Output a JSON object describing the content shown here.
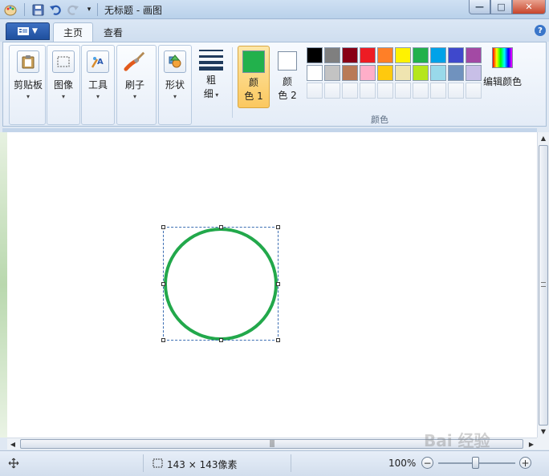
{
  "window": {
    "title": "无标题 - 画图",
    "controls": {
      "minimize": "—",
      "maximize": "□",
      "close": "✕"
    }
  },
  "tabs": [
    {
      "label": "主页",
      "active": true
    },
    {
      "label": "查看",
      "active": false
    }
  ],
  "help": "?",
  "ribbon": {
    "clipboard": {
      "label": "剪贴板"
    },
    "image": {
      "label": "图像"
    },
    "tools": {
      "label": "工具"
    },
    "brushes": {
      "label": "刷子"
    },
    "shapes": {
      "label": "形状"
    },
    "size": {
      "line1": "粗",
      "line2": "细"
    },
    "color1": {
      "line1": "颜",
      "line2": "色 1",
      "color": "#22b14c"
    },
    "color2": {
      "line1": "颜",
      "line2": "色 2",
      "color": "#ffffff"
    },
    "palette": [
      "#000000",
      "#7f7f7f",
      "#880015",
      "#ed1c24",
      "#ff7f27",
      "#fff200",
      "#22b14c",
      "#00a2e8",
      "#3f48cc",
      "#a349a4",
      "#ffffff",
      "#c3c3c3",
      "#b97a57",
      "#ffaec9",
      "#ffc90e",
      "#efe4b0",
      "#b5e61d",
      "#99d9ea",
      "#7092be",
      "#c8bfe7"
    ],
    "edit_colors": "编辑颜色",
    "colors_group_label": "颜色"
  },
  "canvas": {
    "shape": "ellipse",
    "stroke_color": "#22a84b"
  },
  "status": {
    "selection_size": "143 × 143像素",
    "zoom": "100%",
    "zoom_level": 100
  },
  "watermark": "Bai 经验"
}
